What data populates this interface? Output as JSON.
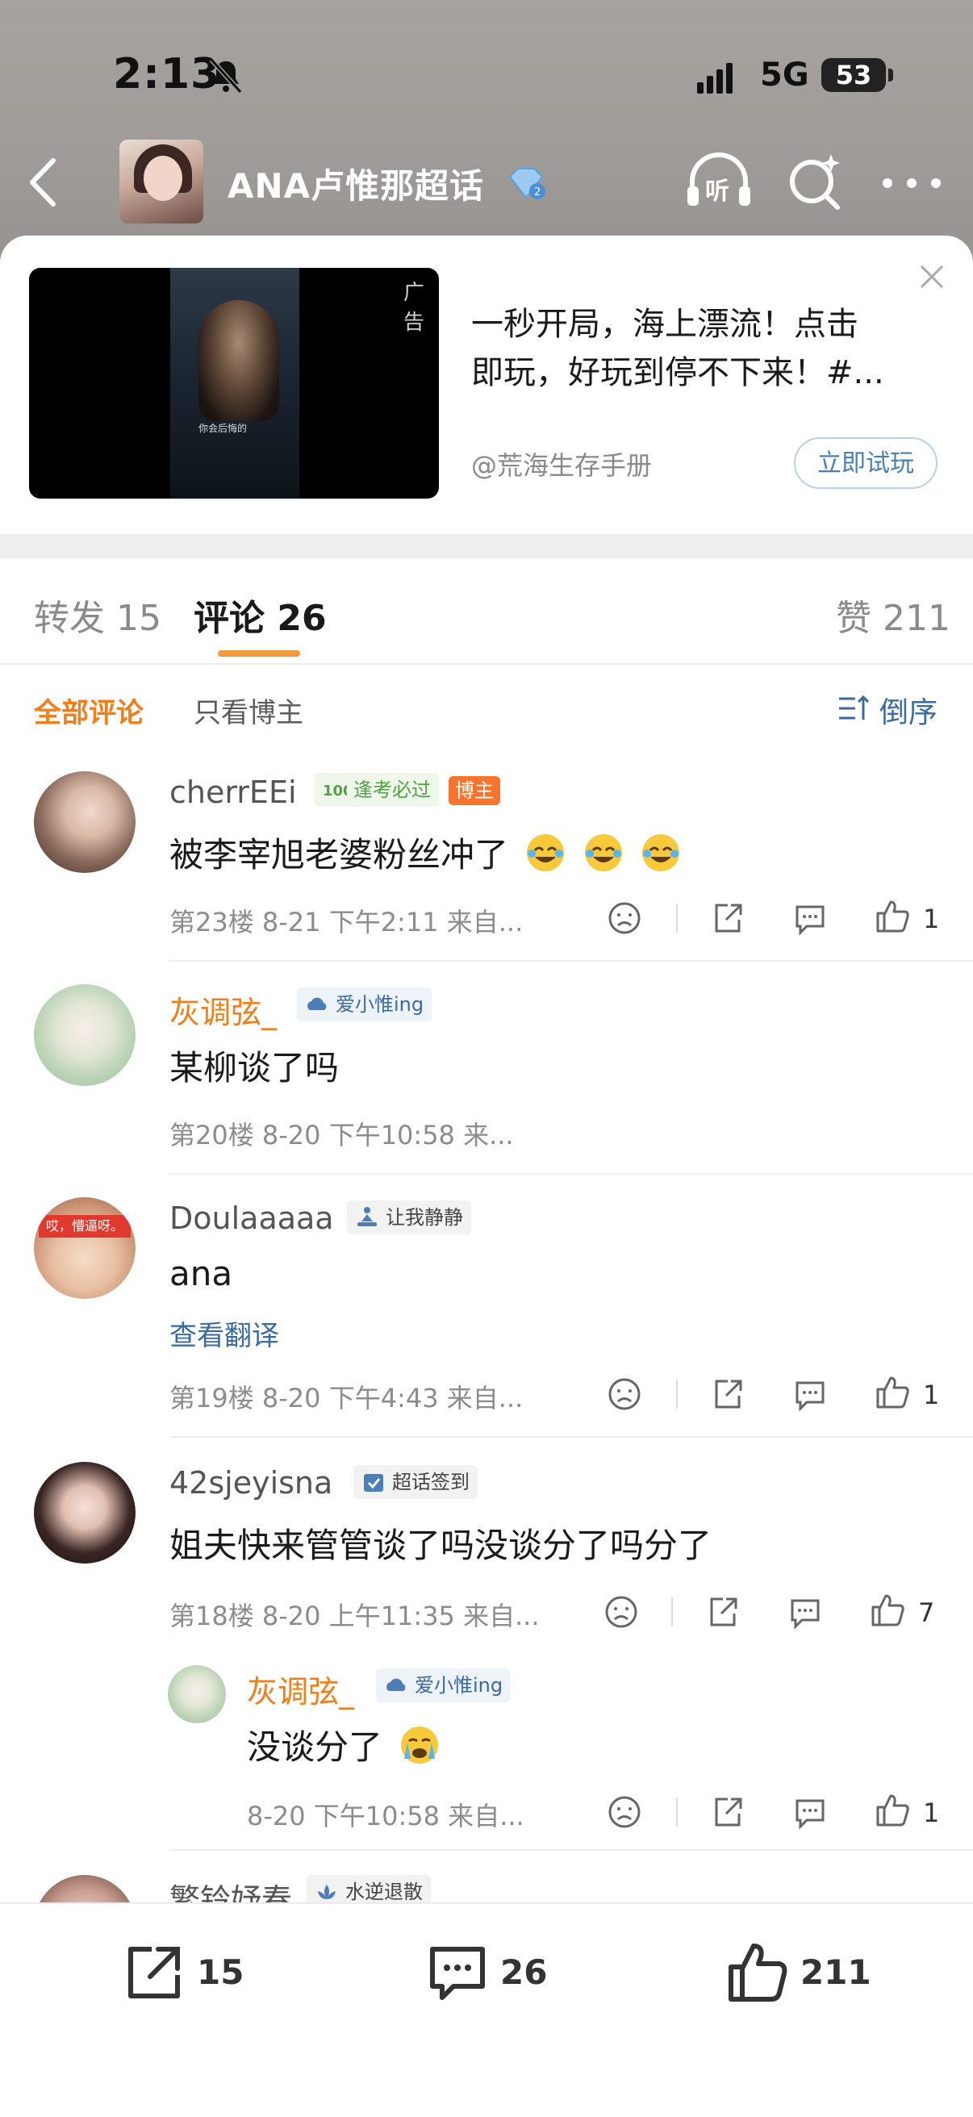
{
  "status_bar": {
    "time": "2:13",
    "network": "5G",
    "battery": "53"
  },
  "nav": {
    "title": "ANA卢惟那超话"
  },
  "ad": {
    "tag": "广告",
    "caption": "你会后悔的",
    "text_line1": "一秒开局，海上漂流！点击",
    "text_line2": "即玩，好玩到停不下来！#...",
    "source": "@荒海生存手册",
    "button": "立即试玩"
  },
  "tabs": {
    "repost_label": "转发",
    "repost_count": "15",
    "comment_label": "评论",
    "comment_count": "26",
    "like_label": "赞",
    "like_count": "211"
  },
  "filter": {
    "all": "全部评论",
    "owner_only": "只看博主",
    "sort": "倒序"
  },
  "comments": [
    {
      "username": "cherrEEi",
      "badge": "逢考必过",
      "owner_tag": "博主",
      "text": "被李宰旭老婆粉丝冲了",
      "meta": "第23楼 8-21 下午2:11 来自...",
      "likes": "1"
    },
    {
      "username": "灰调弦_",
      "badge": "爱小惟ing",
      "text": "某柳谈了吗",
      "meta": "第20楼 8-20 下午10:58 来..."
    },
    {
      "username": "Doulaaaaa",
      "badge": "让我静静",
      "text": "ana",
      "translate": "查看翻译",
      "meta": "第19楼 8-20 下午4:43 来自...",
      "likes": "1",
      "avatar_text": "哎，懵逼呀。"
    },
    {
      "username": "42sjeyisna",
      "badge": "超话签到",
      "text": "姐夫快来管管谈了吗没谈分了吗分了",
      "meta": "第18楼 8-20 上午11:35 来自...",
      "likes": "7"
    },
    {
      "username": "灰调弦_",
      "badge": "爱小惟ing",
      "text": "没谈分了",
      "meta": "8-20 下午10:58 来自...",
      "likes": "1"
    },
    {
      "username": "繁铃妤春",
      "badge": "水逆退散"
    }
  ],
  "bottom_bar": {
    "repost": "15",
    "comment": "26",
    "like": "211"
  }
}
